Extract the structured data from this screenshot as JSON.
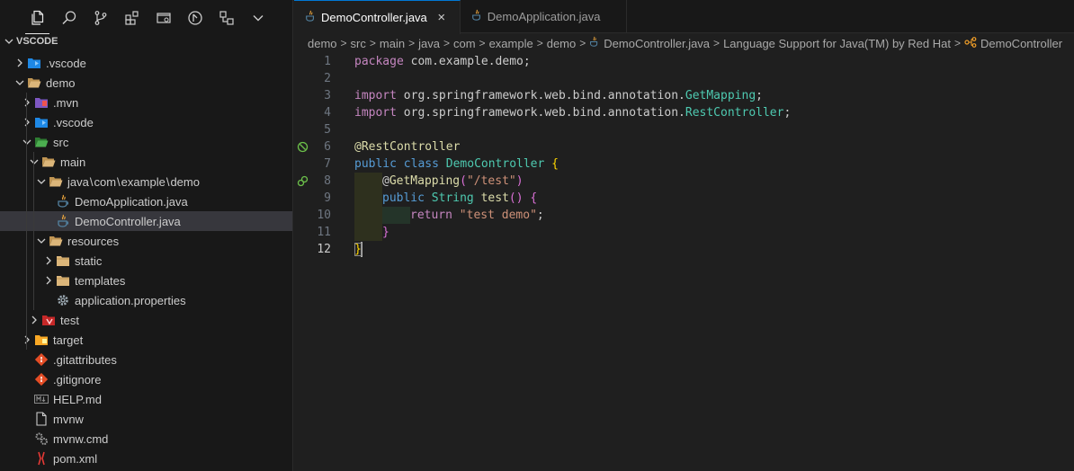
{
  "explorer": {
    "title": "VSCODE",
    "items": [
      {
        "label": ".vscode"
      },
      {
        "label": "demo"
      },
      {
        "label": ".mvn"
      },
      {
        "label": ".vscode"
      },
      {
        "label": "src"
      },
      {
        "label": "main"
      },
      {
        "label_parts": [
          "java",
          "com",
          "example",
          "demo"
        ]
      },
      {
        "label": "DemoApplication.java"
      },
      {
        "label": "DemoController.java"
      },
      {
        "label": "resources"
      },
      {
        "label": "static"
      },
      {
        "label": "templates"
      },
      {
        "label": "application.properties"
      },
      {
        "label": "test"
      },
      {
        "label": "target"
      },
      {
        "label": ".gitattributes"
      },
      {
        "label": ".gitignore"
      },
      {
        "label": "HELP.md"
      },
      {
        "label": "mvnw"
      },
      {
        "label": "mvnw.cmd"
      },
      {
        "label": "pom.xml"
      }
    ]
  },
  "tabs": [
    {
      "label": "DemoController.java",
      "active": true
    },
    {
      "label": "DemoApplication.java",
      "active": false
    }
  ],
  "breadcrumbs": [
    "demo",
    "src",
    "main",
    "java",
    "com",
    "example",
    "demo",
    "DemoController.java",
    "Language Support for Java(TM) by Red Hat",
    "DemoController"
  ],
  "code": {
    "line_numbers": [
      "1",
      "2",
      "3",
      "4",
      "5",
      "6",
      "7",
      "8",
      "9",
      "10",
      "11",
      "12"
    ],
    "active_line": "12",
    "package_kw": "package",
    "package_name": "com.example.demo;",
    "import_kw": "import",
    "import1_path": "org.springframework.web.bind.annotation.",
    "import1_class": "GetMapping",
    "import2_path": "org.springframework.web.bind.annotation.",
    "import2_class": "RestController",
    "semicolon": ";",
    "annotation_class": "@RestController",
    "public_kw": "public",
    "class_kw": "class",
    "class_name": "DemoController",
    "at": "@",
    "mapping_name": "GetMapping",
    "mapping_arg": "\"/test\"",
    "return_type": "String",
    "method_name": "test",
    "return_kw": "return",
    "return_value": "\"test demo\""
  },
  "colors": {
    "accent": "#0078d4",
    "java_icon": "#e8a33d",
    "folder": "#dcb67a",
    "src_folder": "#4caf50",
    "git": "#e44d26"
  }
}
